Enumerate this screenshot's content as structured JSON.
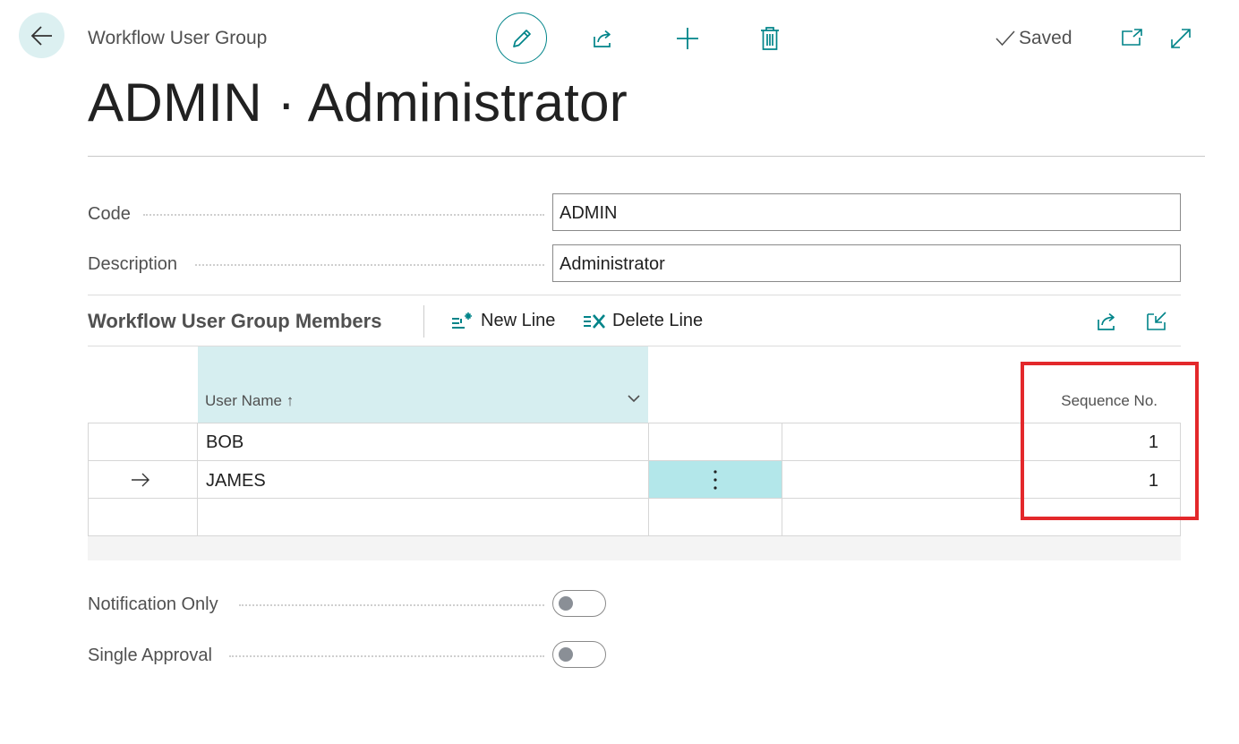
{
  "header": {
    "caption": "Workflow User Group",
    "title": "ADMIN · Administrator",
    "status": "Saved"
  },
  "fields": {
    "code": {
      "label": "Code",
      "value": "ADMIN"
    },
    "description": {
      "label": "Description",
      "value": "Administrator"
    }
  },
  "members_part": {
    "title": "Workflow User Group Members",
    "actions": {
      "new_line": "New Line",
      "delete_line": "Delete Line"
    },
    "columns": {
      "user_name": "User Name",
      "sequence_no": "Sequence No."
    },
    "rows": [
      {
        "user_name": "BOB",
        "sequence_no": "1"
      },
      {
        "user_name": "JAMES",
        "sequence_no": "1"
      }
    ]
  },
  "options": {
    "notification_only": {
      "label": "Notification Only",
      "on": false
    },
    "single_approval": {
      "label": "Single Approval",
      "on": false
    }
  },
  "colors": {
    "accent": "#008489",
    "selected_header": "#d6eef0",
    "selected_cell": "#b3e7ea",
    "highlight": "#e3282b"
  }
}
